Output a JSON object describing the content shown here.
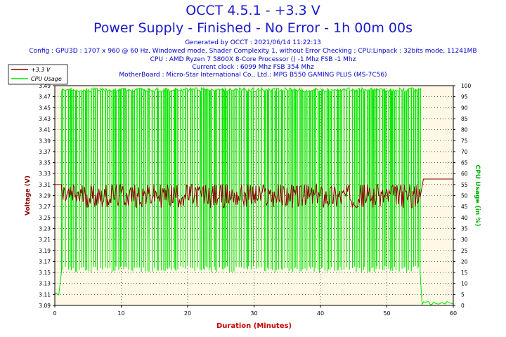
{
  "header": {
    "title": "OCCT 4.5.1 - +3.3 V",
    "subtitle": "Power Supply - Finished - No Error - 1h 00m 00s",
    "info_lines": [
      "Generated by OCCT : 2021/06/14 11:22:13",
      "Config : GPU3D : 1707 x 960 @ 60 Hz, Windowed mode, Shader Complexity 1, without Error Checking ; CPU:Linpack : 32bits mode, 11241MB",
      "CPU : AMD Ryzen 7 5800X 8-Core Processor () -1 Mhz FSB -1 Mhz",
      "Current clock : 6099 Mhz FSB 354 Mhz",
      "MotherBoard : Micro-Star International Co., Ltd.: MPG B550 GAMING PLUS (MS-7C56)"
    ]
  },
  "chart_data": {
    "type": "line",
    "xlabel": "Duration (Minutes)",
    "ylabel": "Voltage (V)",
    "y2label": "CPU Usage (in %)",
    "xlim": [
      0,
      60
    ],
    "ylim": [
      3.09,
      3.49
    ],
    "y2lim": [
      0,
      100
    ],
    "x_ticks": [
      "0",
      "10",
      "20",
      "30",
      "40",
      "50",
      "60"
    ],
    "y_ticks": [
      "3.09",
      "3.11",
      "3.13",
      "3.15",
      "3.17",
      "3.19",
      "3.21",
      "3.23",
      "3.25",
      "3.27",
      "3.29",
      "3.31",
      "3.33",
      "3.35",
      "3.37",
      "3.39",
      "3.41",
      "3.43",
      "3.45",
      "3.47",
      "3.49"
    ],
    "y2_ticks": [
      "0",
      "5",
      "10",
      "15",
      "20",
      "25",
      "30",
      "35",
      "40",
      "45",
      "50",
      "55",
      "60",
      "65",
      "70",
      "75",
      "80",
      "85",
      "90",
      "95",
      "100"
    ],
    "grid": true,
    "legend_position": "top-left",
    "colors": {
      "voltage": "#8b0000",
      "cpu": "#00e600",
      "plot_bg": "#fff8e6",
      "axis_text_left": "#8b0000",
      "axis_text_right": "#00b000",
      "xlabel_color": "#c80000"
    },
    "series": [
      {
        "name": "+3.3 V",
        "axis": "left",
        "segments": [
          {
            "x_range": [
              0,
              1
            ],
            "value": 3.31
          },
          {
            "x_range": [
              1,
              55
            ],
            "value_mean": 3.29,
            "value_min": 3.265,
            "value_max": 3.31
          },
          {
            "x_range": [
              55.5,
              60
            ],
            "value": 3.32
          }
        ]
      },
      {
        "name": "CPU Usage",
        "axis": "right",
        "segments": [
          {
            "x_range": [
              0,
              0.6
            ],
            "value": 5
          },
          {
            "x_range": [
              1,
              55
            ],
            "oscillating_between": [
              15,
              99
            ]
          },
          {
            "x_range": [
              55.3,
              60
            ],
            "value": 1
          }
        ]
      }
    ]
  }
}
